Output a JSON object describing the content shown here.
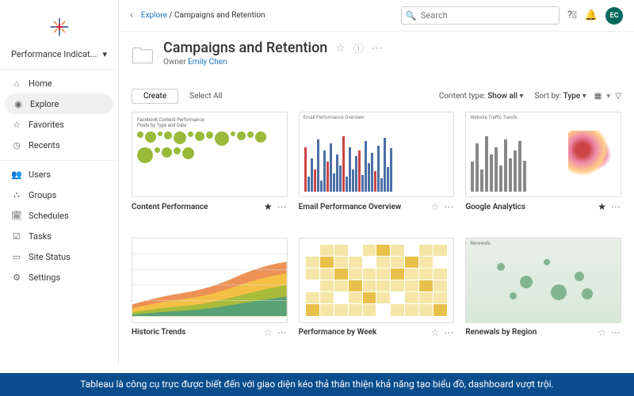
{
  "sidebar": {
    "perf_label": "Performance Indicat...",
    "nav1": [
      {
        "icon": "home",
        "label": "Home"
      },
      {
        "icon": "compass",
        "label": "Explore"
      },
      {
        "icon": "star",
        "label": "Favorites"
      },
      {
        "icon": "clock",
        "label": "Recents"
      }
    ],
    "nav2": [
      {
        "icon": "users",
        "label": "Users"
      },
      {
        "icon": "groups",
        "label": "Groups"
      },
      {
        "icon": "sched",
        "label": "Schedules"
      },
      {
        "icon": "tasks",
        "label": "Tasks"
      },
      {
        "icon": "site",
        "label": "Site Status"
      },
      {
        "icon": "gear",
        "label": "Settings"
      }
    ]
  },
  "breadcrumb": {
    "root": "Explore",
    "sep": " / ",
    "leaf": "Campaigns and Retention"
  },
  "search": {
    "placeholder": "Search"
  },
  "avatar": "EC",
  "header": {
    "title": "Campaigns and Retention",
    "owner_label": "Owner",
    "owner_name": "Emily Chen"
  },
  "toolbar": {
    "create": "Create",
    "select_all": "Select All",
    "content_type_label": "Content type:",
    "content_type_value": "Show all",
    "sort_label": "Sort by:",
    "sort_value": "Type"
  },
  "cards": [
    {
      "name": "Content Performance",
      "star": true,
      "thumb_title": "Facebook Content Performance",
      "thumb_sub": "Posts by Type and Date"
    },
    {
      "name": "Email Performance Overview",
      "star": false,
      "thumb_title": "Email Performance Overview"
    },
    {
      "name": "Google Analytics",
      "star": true,
      "thumb_title": "Website Traffic Trends"
    },
    {
      "name": "Historic Trends",
      "star": false,
      "thumb_title": ""
    },
    {
      "name": "Performance by Week",
      "star": false,
      "thumb_title": ""
    },
    {
      "name": "Renewals by Region",
      "star": false,
      "thumb_title": "Renewals"
    }
  ],
  "caption": "Tableau là công cụ trực được biết đến với giao diện kéo thả thân thiện khả năng tạo biểu đồ, dashboard vượt trội."
}
